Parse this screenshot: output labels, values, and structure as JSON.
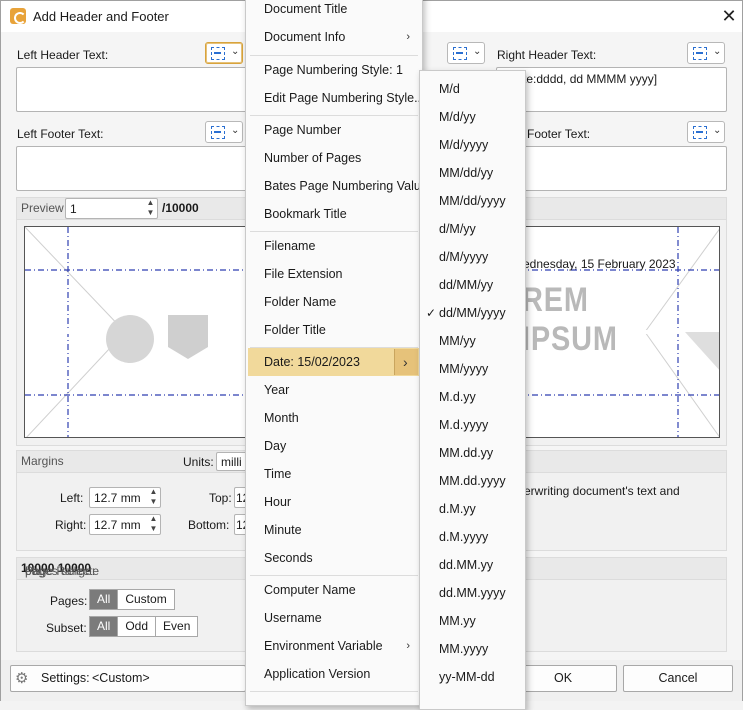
{
  "window": {
    "title": "Add Header and Footer"
  },
  "fields": {
    "left_header_label": "Left Header Text:",
    "right_header_label": "Right Header Text:",
    "right_header_value": "te:dddd, dd MMMM yyyy]",
    "left_footer_label": "Left Footer Text:",
    "right_footer_label": "Footer Text:"
  },
  "preview": {
    "label": "Preview",
    "page_value": "1",
    "total": "/10000",
    "date_text": "ednesday, 15 February 2023",
    "lorem_text": "REM IPSUM"
  },
  "margins": {
    "title": "Margins",
    "units_label": "Units:",
    "units_value": "milli",
    "left_label": "Left:",
    "left_value": "12.7 mm",
    "right_label": "Right:",
    "right_value": "12.7 mm",
    "top_label": "Top:",
    "top_value": "12",
    "bottom_label": "Bottom:",
    "bottom_value": "12",
    "overlap_text": "erwriting document's text and"
  },
  "page_range": {
    "prefix": "Page Range:",
    "count": "10000",
    "of": "of",
    "total": "10000",
    "suffix": "pages selecte",
    "pages_label": "Pages:",
    "pages_options": [
      "All",
      "Custom"
    ],
    "subset_label": "Subset:",
    "subset_options": [
      "All",
      "Odd",
      "Even"
    ]
  },
  "bottom": {
    "settings_label": "Settings:",
    "settings_value": "<Custom>",
    "ok": "OK",
    "cancel": "Cancel"
  },
  "menu": {
    "items": [
      {
        "label": "Document Title"
      },
      {
        "label": "Document Info",
        "submenu": true
      },
      {
        "label": "Page Numbering Style: 1"
      },
      {
        "label": "Edit Page Numbering Style..."
      },
      {
        "label": "Page Number"
      },
      {
        "label": "Number of Pages"
      },
      {
        "label": "Bates Page Numbering Value"
      },
      {
        "label": "Bookmark Title"
      },
      {
        "label": "Filename"
      },
      {
        "label": "File Extension"
      },
      {
        "label": "Folder Name"
      },
      {
        "label": "Folder Title"
      },
      {
        "label": "Date: 15/02/2023",
        "submenu": true
      },
      {
        "label": "Year"
      },
      {
        "label": "Month"
      },
      {
        "label": "Day"
      },
      {
        "label": "Time"
      },
      {
        "label": "Hour"
      },
      {
        "label": "Minute"
      },
      {
        "label": "Seconds"
      },
      {
        "label": "Computer Name"
      },
      {
        "label": "Username"
      },
      {
        "label": "Environment Variable",
        "submenu": true
      },
      {
        "label": "Application Version"
      }
    ]
  },
  "date_submenu": {
    "selected": "dd/MM/yyyy",
    "items": [
      "M/d",
      "M/d/yy",
      "M/d/yyyy",
      "MM/dd/yy",
      "MM/dd/yyyy",
      "d/M/yy",
      "d/M/yyyy",
      "dd/MM/yy",
      "dd/MM/yyyy",
      "MM/yy",
      "MM/yyyy",
      "M.d.yy",
      "M.d.yyyy",
      "MM.dd.yy",
      "MM.dd.yyyy",
      "d.M.yy",
      "d.M.yyyy",
      "dd.MM.yy",
      "dd.MM.yyyy",
      "MM.yy",
      "MM.yyyy",
      "yy-MM-dd"
    ]
  }
}
